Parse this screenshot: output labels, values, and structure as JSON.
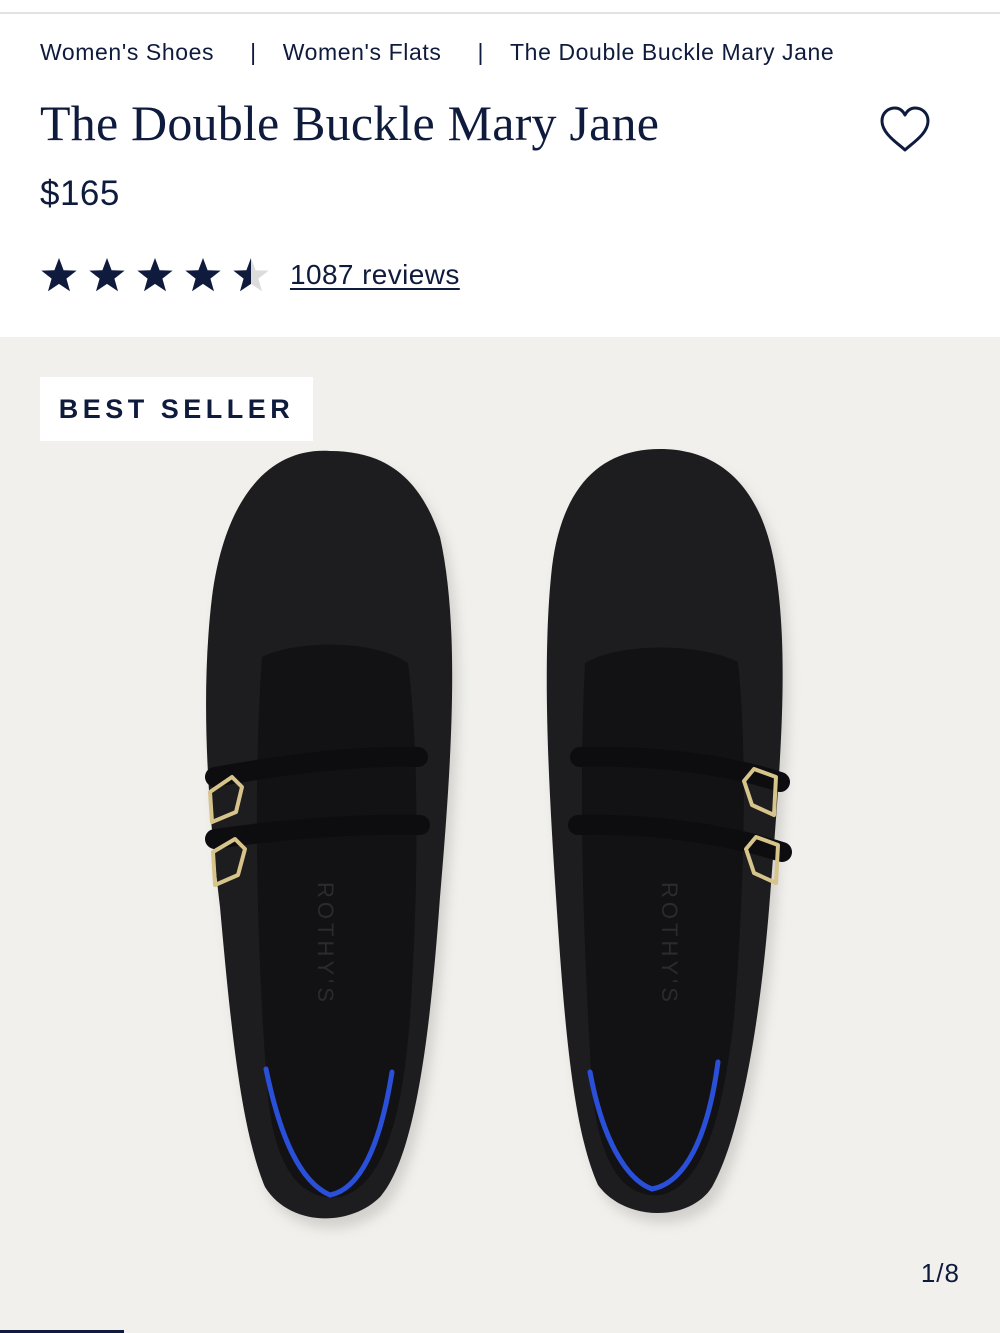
{
  "breadcrumb": {
    "items": [
      "Women's Shoes",
      "Women's Flats",
      "The Double Buckle Mary Jane"
    ],
    "separator": "|"
  },
  "product": {
    "title": "The Double Buckle Mary Jane",
    "price": "$165",
    "rating": 4.5,
    "rating_max": 5,
    "reviews_label": "1087 reviews"
  },
  "gallery": {
    "badge": "BEST SELLER",
    "counter": "1/8",
    "current_index": 1,
    "total": 8,
    "insole_brand": "ROTHY'S"
  },
  "colors": {
    "navy": "#0f1b3d",
    "gallery_bg": "#f1f0ed",
    "shoe": "#1d1d1f",
    "accent_blue": "#2a4fd8",
    "buckle_gold": "#d6c48a"
  },
  "icons": {
    "favorite": "heart-outline-icon",
    "star": "star-icon"
  }
}
